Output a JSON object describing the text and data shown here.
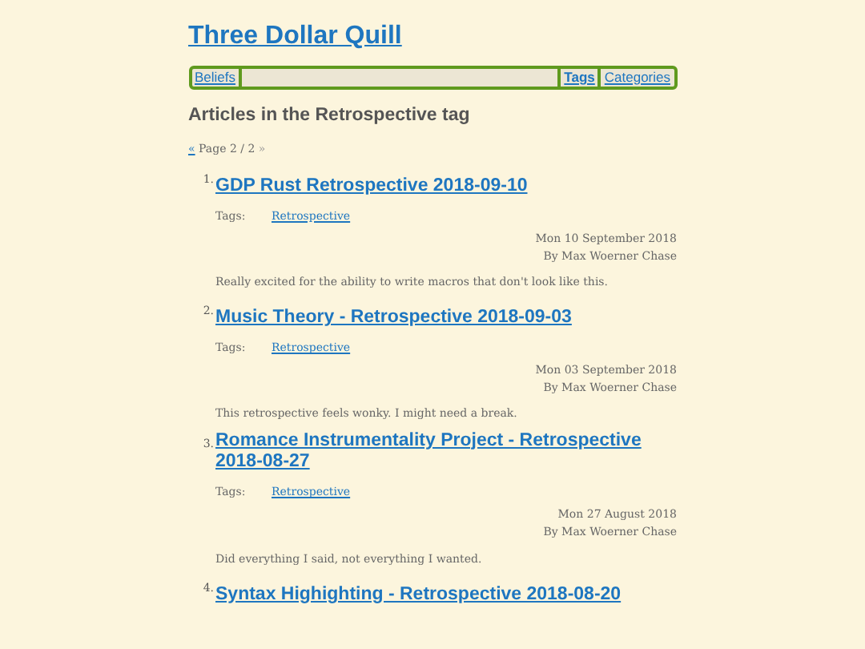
{
  "site_title": "Three Dollar Quill",
  "nav": {
    "left": [
      {
        "label": "Beliefs",
        "selected": false
      }
    ],
    "right": [
      {
        "label": "Tags",
        "selected": true
      },
      {
        "label": "Categories",
        "selected": false
      }
    ]
  },
  "heading": "Articles in the Retrospective tag",
  "pagination": {
    "prev": "«",
    "page": "Page 2 / 2",
    "next": "»"
  },
  "articles": [
    {
      "number": "1.",
      "title": "GDP Rust Retrospective 2018-09-10",
      "tags_label": "Tags:",
      "tags": [
        "Retrospective"
      ],
      "date": "Mon 10 September 2018",
      "author": "By Max Woerner Chase",
      "summary": "Really excited for the ability to write macros that don't look like this."
    },
    {
      "number": "2.",
      "title": "Music Theory - Retrospective 2018-09-03",
      "tags_label": "Tags:",
      "tags": [
        "Retrospective"
      ],
      "date": "Mon 03 September 2018",
      "author": "By Max Woerner Chase",
      "summary": "This retrospective feels wonky. I might need a break."
    },
    {
      "number": "3.",
      "title": "Romance Instrumentality Project - Retrospective 2018-08-27",
      "tags_label": "Tags:",
      "tags": [
        "Retrospective"
      ],
      "date": "Mon 27 August 2018",
      "author": "By Max Woerner Chase",
      "summary": "Did everything I said, not everything I wanted."
    },
    {
      "number": "4.",
      "title": "Syntax Highighting - Retrospective 2018-08-20"
    }
  ]
}
